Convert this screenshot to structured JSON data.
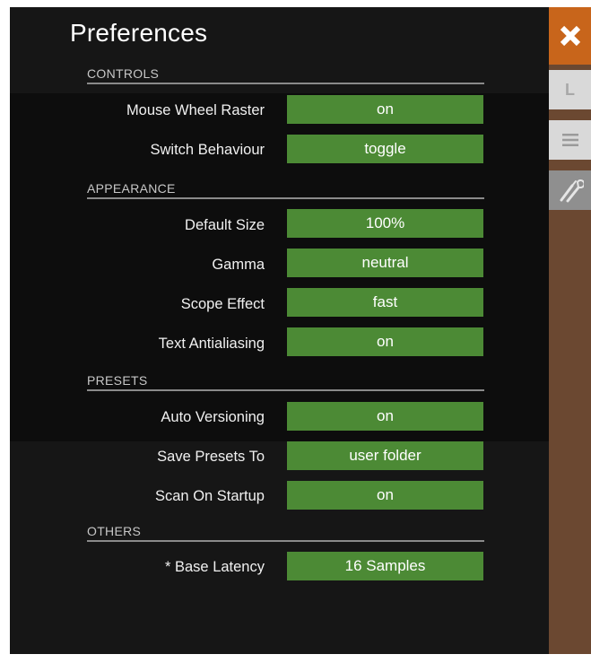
{
  "window": {
    "title": "Preferences"
  },
  "sections": {
    "controls": "CONTROLS",
    "appearance": "APPEARANCE",
    "presets": "PRESETS",
    "others": "OTHERS"
  },
  "settings": {
    "mouse_wheel_raster": {
      "label": "Mouse Wheel Raster",
      "value": "on"
    },
    "switch_behaviour": {
      "label": "Switch Behaviour",
      "value": "toggle"
    },
    "default_size": {
      "label": "Default Size",
      "value": "100%"
    },
    "gamma": {
      "label": "Gamma",
      "value": "neutral"
    },
    "scope_effect": {
      "label": "Scope Effect",
      "value": "fast"
    },
    "text_antialiasing": {
      "label": "Text Antialiasing",
      "value": "on"
    },
    "auto_versioning": {
      "label": "Auto Versioning",
      "value": "on"
    },
    "save_presets_to": {
      "label": "Save Presets To",
      "value": "user folder"
    },
    "scan_on_startup": {
      "label": "Scan On Startup",
      "value": "on"
    },
    "base_latency": {
      "label": "* Base Latency",
      "value": "16 Samples"
    }
  },
  "sidebar": {
    "close_icon": "close-icon",
    "tab_l_label": "L",
    "menu_icon": "menu-icon",
    "tools_icon": "wrench-screwdriver-icon"
  },
  "colors": {
    "value_green": "#4c8a35",
    "close_orange": "#c8651b",
    "sidebar_brown": "#6b4831",
    "panel_dark": "#161616"
  }
}
